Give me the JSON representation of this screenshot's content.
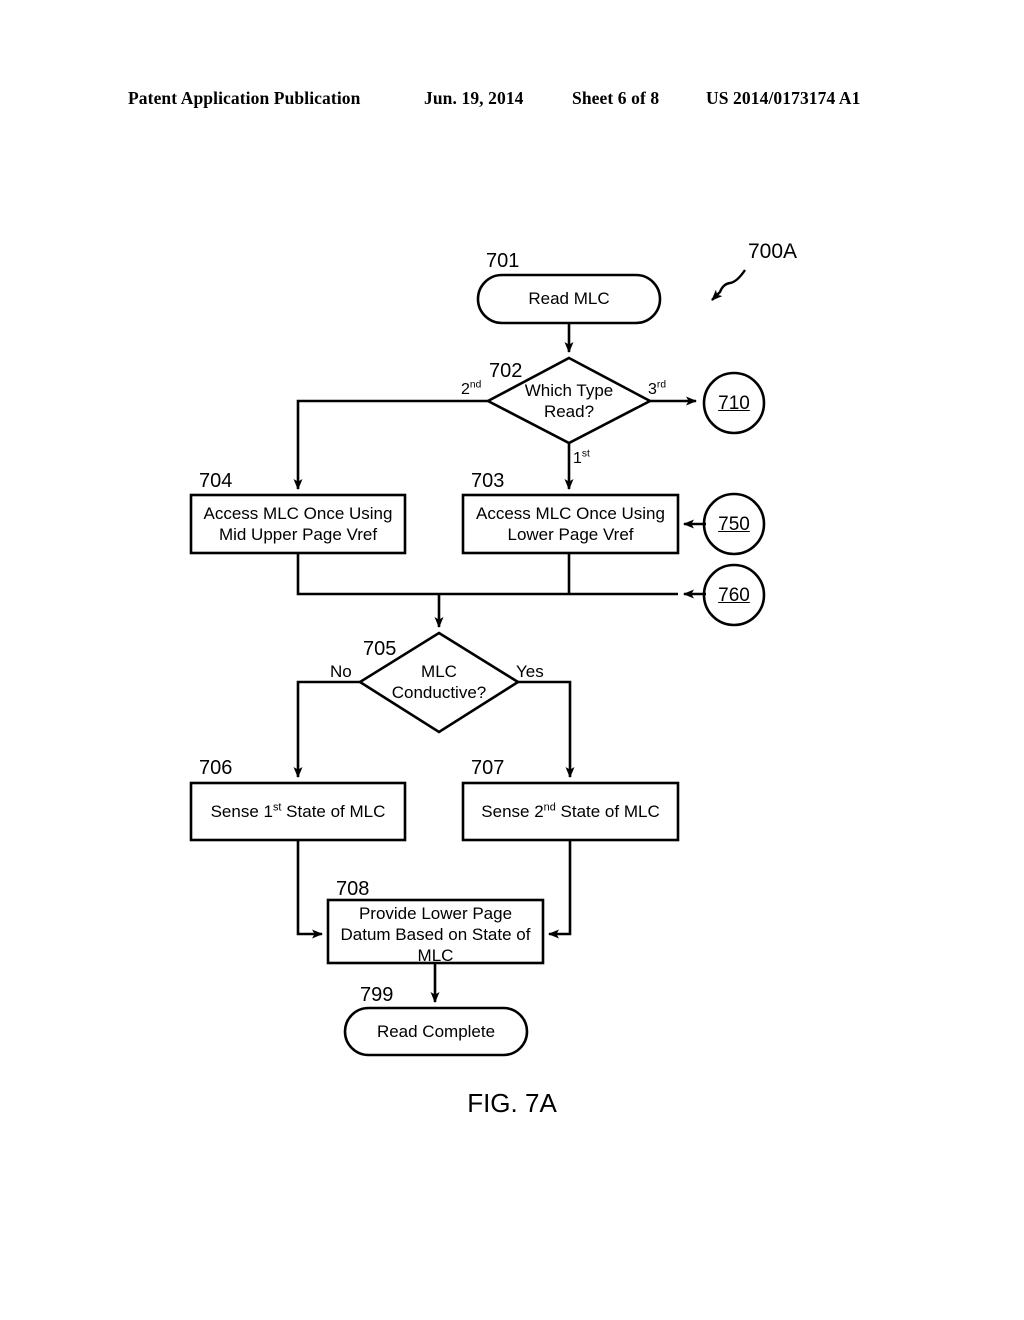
{
  "header": {
    "publication": "Patent Application Publication",
    "date": "Jun. 19, 2014",
    "sheet": "Sheet 6 of 8",
    "patent_number": "US 2014/0173174 A1"
  },
  "figure": {
    "caption": "FIG. 7A",
    "diagram_label": "700A"
  },
  "nodes": {
    "n701": {
      "ref": "701",
      "type": "terminator",
      "text": "Read MLC"
    },
    "n702": {
      "ref": "702",
      "type": "decision",
      "line1": "Which Type",
      "line2": "Read?"
    },
    "n703": {
      "ref": "703",
      "type": "process",
      "line1": "Access MLC Once Using",
      "line2": "Lower Page Vref"
    },
    "n704": {
      "ref": "704",
      "type": "process",
      "line1": "Access MLC Once Using",
      "line2": "Mid Upper Page Vref"
    },
    "n705": {
      "ref": "705",
      "type": "decision",
      "line1": "MLC",
      "line2": "Conductive?"
    },
    "n706": {
      "ref": "706",
      "type": "process",
      "prefix": "Sense 1",
      "sup": "st",
      "suffix": " State of MLC"
    },
    "n707": {
      "ref": "707",
      "type": "process",
      "prefix": "Sense 2",
      "sup": "nd",
      "suffix": " State of MLC"
    },
    "n708": {
      "ref": "708",
      "type": "process",
      "line1": "Provide Lower Page",
      "line2": "Datum Based on State of",
      "line3": "MLC"
    },
    "n799": {
      "ref": "799",
      "type": "terminator",
      "text": "Read Complete"
    }
  },
  "connectors": {
    "c710": {
      "label": "710",
      "direction": "out"
    },
    "c750": {
      "label": "750",
      "direction": "in"
    },
    "c760": {
      "label": "760",
      "direction": "in"
    }
  },
  "edge_labels": {
    "e_2nd_prefix": "2",
    "e_2nd_sup": "nd",
    "e_3rd_prefix": "3",
    "e_3rd_sup": "rd",
    "e_1st_prefix": "1",
    "e_1st_sup": "st",
    "e_no": "No",
    "e_yes": "Yes"
  },
  "colors": {
    "stroke": "#000000",
    "background": "#ffffff"
  }
}
